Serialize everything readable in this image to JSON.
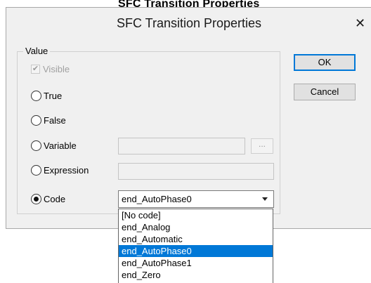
{
  "window": {
    "top_text": "SFC Transition Properties",
    "title": "SFC Transition Properties",
    "close_glyph": "✕"
  },
  "group": {
    "label": "Value",
    "visible_label": "Visible",
    "visible_checked": true
  },
  "options": [
    {
      "label": "True",
      "checked": false
    },
    {
      "label": "False",
      "checked": false
    },
    {
      "label": "Variable",
      "checked": false
    },
    {
      "label": "Expression",
      "checked": false
    },
    {
      "label": "Code",
      "checked": true
    }
  ],
  "variable_field": {
    "value": ""
  },
  "expression_field": {
    "value": ""
  },
  "browse_button": {
    "label": "..."
  },
  "code_combo": {
    "value": "end_AutoPhase0"
  },
  "dropdown_items": [
    "[No code]",
    "end_Analog",
    "end_Automatic",
    "end_AutoPhase0",
    "end_AutoPhase1",
    "end_Zero"
  ],
  "selected_index": 3,
  "buttons": {
    "ok": "OK",
    "cancel": "Cancel"
  },
  "colors": {
    "selection": "#0078d7",
    "dialog_bg": "#f0f0f0"
  }
}
